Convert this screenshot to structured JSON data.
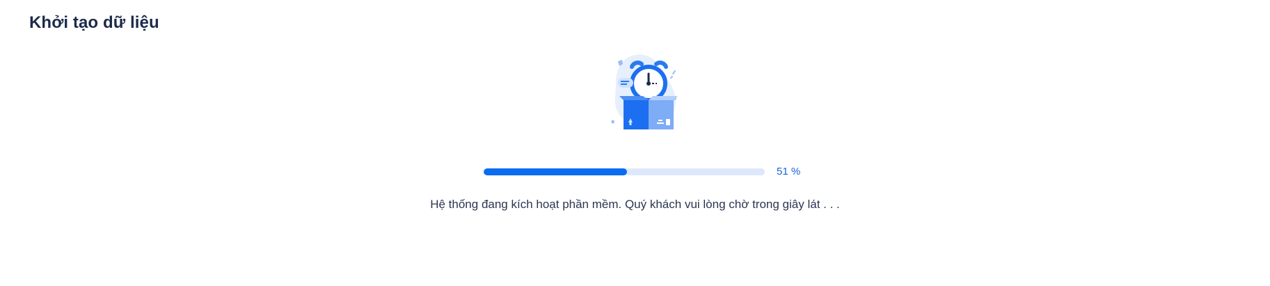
{
  "page": {
    "title": "Khởi tạo dữ liệu"
  },
  "illustration": {
    "icon": "alarm-clock-box-icon"
  },
  "progress": {
    "percent": 51,
    "label": "51 %",
    "colors": {
      "fill": "#0a6cf0",
      "track": "#dde8fb"
    }
  },
  "status": {
    "message": "Hệ thống đang kích hoạt phần mềm. Quý khách vui lòng chờ trong giây lát . . ."
  }
}
